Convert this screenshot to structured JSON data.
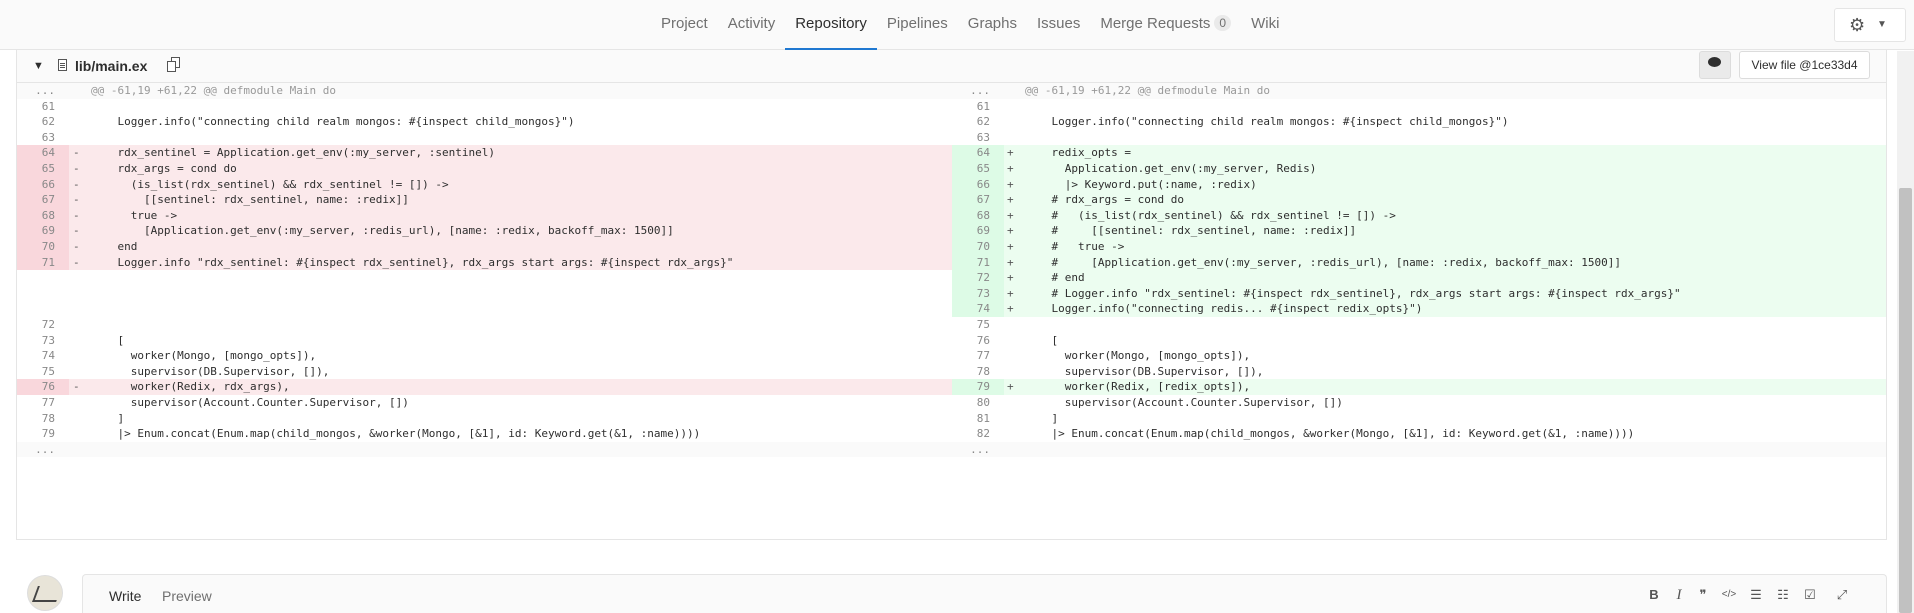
{
  "nav": {
    "items": [
      {
        "label": "Project",
        "active": false
      },
      {
        "label": "Activity",
        "active": false
      },
      {
        "label": "Repository",
        "active": true
      },
      {
        "label": "Pipelines",
        "active": false
      },
      {
        "label": "Graphs",
        "active": false
      },
      {
        "label": "Issues",
        "active": false
      },
      {
        "label": "Merge Requests",
        "active": false,
        "badge": "0"
      },
      {
        "label": "Wiki",
        "active": false
      }
    ],
    "settings_icon": "gear-icon",
    "accent_color": "#1f78d1"
  },
  "file": {
    "name": "lib/main.ex",
    "view_file_label": "View file @1ce33d4"
  },
  "diff": {
    "rows": [
      {
        "type": "match",
        "l_ln": "...",
        "l_code": "@@ -61,19 +61,22 @@ defmodule Main do",
        "r_ln": "...",
        "r_code": "@@ -61,19 +61,22 @@ defmodule Main do"
      },
      {
        "type": "ctx",
        "l_ln": "61",
        "l_code": "",
        "r_ln": "61",
        "r_code": ""
      },
      {
        "type": "ctx",
        "l_ln": "62",
        "l_code": "    Logger.info(\"connecting child realm mongos: #{inspect child_mongos}\")",
        "r_ln": "62",
        "r_code": "    Logger.info(\"connecting child realm mongos: #{inspect child_mongos}\")"
      },
      {
        "type": "ctx",
        "l_ln": "63",
        "l_code": "",
        "r_ln": "63",
        "r_code": ""
      },
      {
        "type": "both",
        "l_ln": "64",
        "l_code": "    rdx_sentinel = Application.get_env(:my_server, :sentinel)",
        "r_ln": "64",
        "r_code": "    redix_opts ="
      },
      {
        "type": "both",
        "l_ln": "65",
        "l_code": "    rdx_args = cond do",
        "r_ln": "65",
        "r_code": "      Application.get_env(:my_server, Redis)"
      },
      {
        "type": "both",
        "l_ln": "66",
        "l_code": "      (is_list(rdx_sentinel) && rdx_sentinel != []) ->",
        "r_ln": "66",
        "r_code": "      |> Keyword.put(:name, :redix)"
      },
      {
        "type": "both",
        "l_ln": "67",
        "l_code": "        [[sentinel: rdx_sentinel, name: :redix]]",
        "r_ln": "67",
        "r_code": "    # rdx_args = cond do"
      },
      {
        "type": "both",
        "l_ln": "68",
        "l_code": "      true ->",
        "r_ln": "68",
        "r_code": "    #   (is_list(rdx_sentinel) && rdx_sentinel != []) ->"
      },
      {
        "type": "both",
        "l_ln": "69",
        "l_code": "        [Application.get_env(:my_server, :redis_url), [name: :redix, backoff_max: 1500]]",
        "r_ln": "69",
        "r_code": "    #     [[sentinel: rdx_sentinel, name: :redix]]"
      },
      {
        "type": "both",
        "l_ln": "70",
        "l_code": "    end",
        "r_ln": "70",
        "r_code": "    #   true ->"
      },
      {
        "type": "both",
        "l_ln": "71",
        "l_code": "    Logger.info \"rdx_sentinel: #{inspect rdx_sentinel}, rdx_args start args: #{inspect rdx_args}\"",
        "r_ln": "71",
        "r_code": "    #     [Application.get_env(:my_server, :redis_url), [name: :redix, backoff_max: 1500]]"
      },
      {
        "type": "add",
        "l_ln": "",
        "l_code": "",
        "r_ln": "72",
        "r_code": "    # end"
      },
      {
        "type": "add",
        "l_ln": "",
        "l_code": "",
        "r_ln": "73",
        "r_code": "    # Logger.info \"rdx_sentinel: #{inspect rdx_sentinel}, rdx_args start args: #{inspect rdx_args}\""
      },
      {
        "type": "add",
        "l_ln": "",
        "l_code": "",
        "r_ln": "74",
        "r_code": "    Logger.info(\"connecting redis... #{inspect redix_opts}\")"
      },
      {
        "type": "ctx",
        "l_ln": "72",
        "l_code": "",
        "r_ln": "75",
        "r_code": ""
      },
      {
        "type": "ctx",
        "l_ln": "73",
        "l_code": "    [",
        "r_ln": "76",
        "r_code": "    ["
      },
      {
        "type": "ctx",
        "l_ln": "74",
        "l_code": "      worker(Mongo, [mongo_opts]),",
        "r_ln": "77",
        "r_code": "      worker(Mongo, [mongo_opts]),"
      },
      {
        "type": "ctx",
        "l_ln": "75",
        "l_code": "      supervisor(DB.Supervisor, []),",
        "r_ln": "78",
        "r_code": "      supervisor(DB.Supervisor, []),"
      },
      {
        "type": "both",
        "l_ln": "76",
        "l_code": "      worker(Redix, rdx_args),",
        "r_ln": "79",
        "r_code": "      worker(Redix, [redix_opts]),"
      },
      {
        "type": "ctx",
        "l_ln": "77",
        "l_code": "      supervisor(Account.Counter.Supervisor, [])",
        "r_ln": "80",
        "r_code": "      supervisor(Account.Counter.Supervisor, [])"
      },
      {
        "type": "ctx",
        "l_ln": "78",
        "l_code": "    ]",
        "r_ln": "81",
        "r_code": "    ]"
      },
      {
        "type": "ctx",
        "l_ln": "79",
        "l_code": "    |> Enum.concat(Enum.map(child_mongos, &worker(Mongo, [&1], id: Keyword.get(&1, :name))))",
        "r_ln": "82",
        "r_code": "    |> Enum.concat(Enum.map(child_mongos, &worker(Mongo, [&1], id: Keyword.get(&1, :name))))"
      },
      {
        "type": "match",
        "l_ln": "...",
        "l_code": "",
        "r_ln": "...",
        "r_code": ""
      }
    ],
    "colors": {
      "deleted_bg": "#fbe9eb",
      "added_bg": "#ecfdf0"
    }
  },
  "editor": {
    "tabs": [
      {
        "label": "Write",
        "active": true
      },
      {
        "label": "Preview",
        "active": false
      }
    ],
    "tools": [
      {
        "name": "bold-icon",
        "glyph": "B"
      },
      {
        "name": "italic-icon",
        "glyph": "I"
      },
      {
        "name": "quote-icon",
        "glyph": "❞"
      },
      {
        "name": "code-icon",
        "glyph": "</>"
      },
      {
        "name": "bullet-list-icon",
        "glyph": "☰"
      },
      {
        "name": "numbered-list-icon",
        "glyph": "☷"
      },
      {
        "name": "task-list-icon",
        "glyph": "☑"
      },
      {
        "name": "fullscreen-icon",
        "glyph": "⤢"
      }
    ]
  }
}
